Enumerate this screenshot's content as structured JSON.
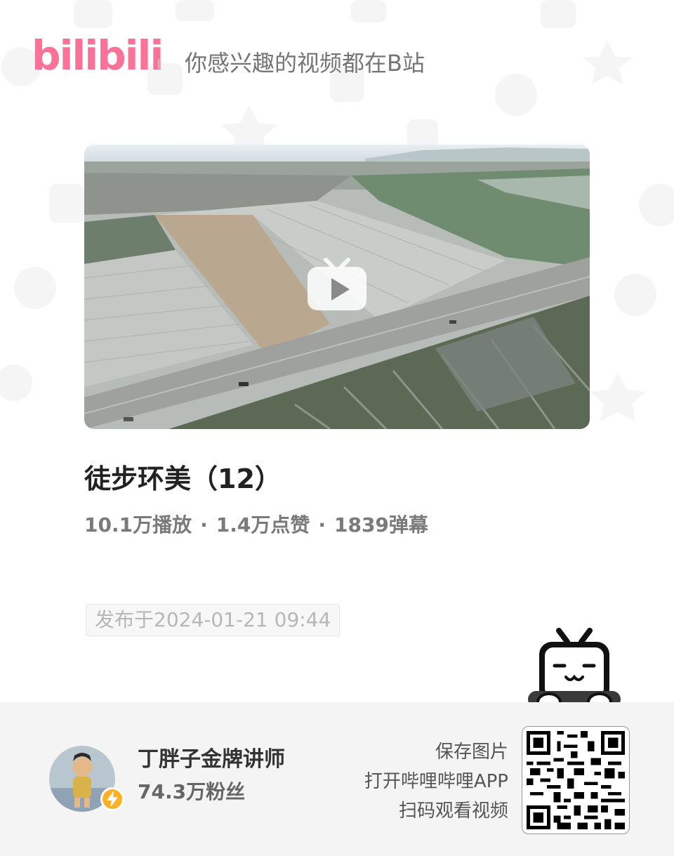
{
  "header": {
    "logo": "bilibili",
    "slogan": "你感兴趣的视频都在B站"
  },
  "video": {
    "title": "徒步环美（12）",
    "plays": "10.1万播放",
    "likes": "1.4万点赞",
    "danmaku": "1839弹幕",
    "separator": "·",
    "publish_date": "发布于2024-01-21 09:44"
  },
  "uploader": {
    "name": "丁胖子金牌讲师",
    "fans": "74.3万粉丝"
  },
  "cta": {
    "line1": "保存图片",
    "line2": "打开哔哩哔哩APP",
    "line3": "扫码观看视频"
  },
  "colors": {
    "brand": "#fb7299",
    "footer_bg": "#f4f4f4",
    "badge": "#ffb027"
  },
  "icons": {
    "play": "play-icon",
    "badge": "lightning-badge-icon",
    "mascot": "tv-mascot-icon",
    "qr": "qr-code-icon"
  }
}
